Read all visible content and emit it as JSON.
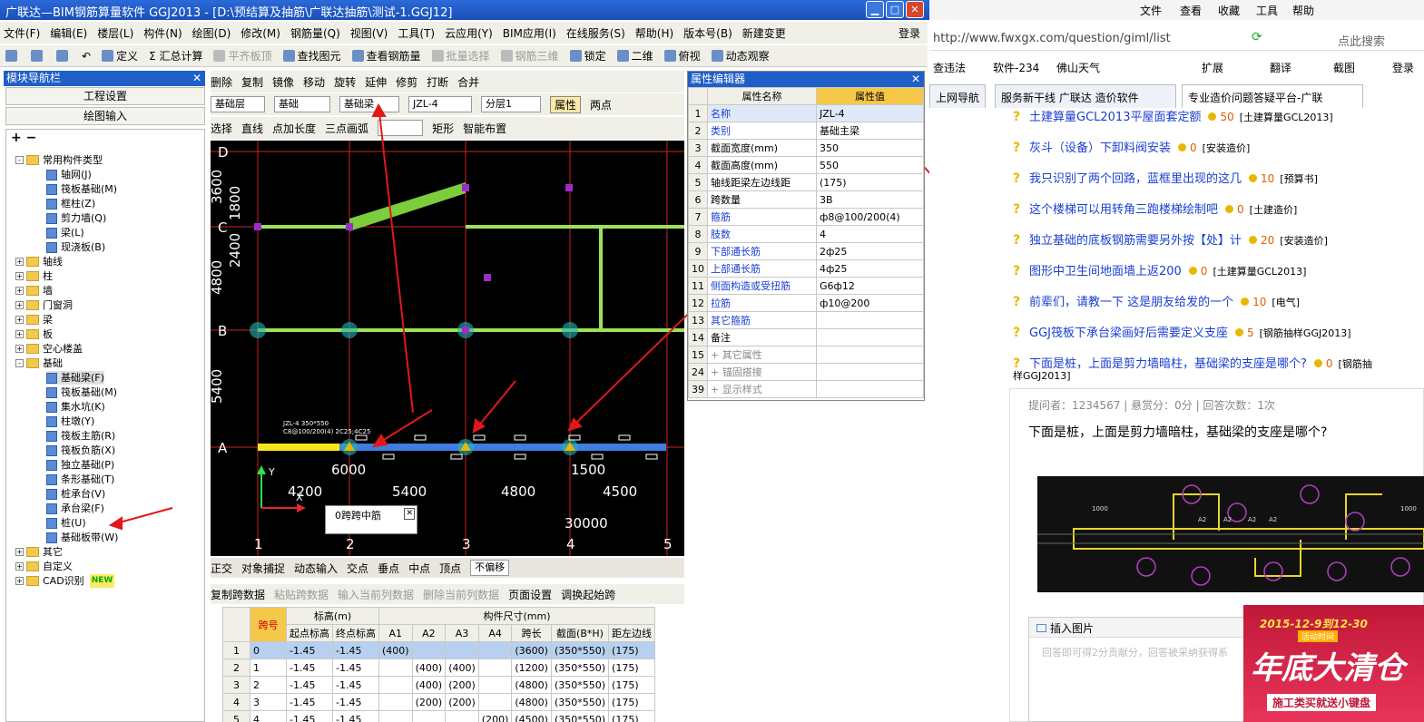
{
  "app": {
    "title": "广联达—BIM钢筋算量软件 GGJ2013 - [D:\\预结算及抽筋\\广联达抽筋\\测试-1.GGJ12]",
    "menu": [
      "文件(F)",
      "编辑(E)",
      "楼层(L)",
      "构件(N)",
      "绘图(D)",
      "修改(M)",
      "钢筋量(Q)",
      "视图(V)",
      "工具(T)",
      "云应用(Y)",
      "BIM应用(I)",
      "在线服务(S)",
      "帮助(H)",
      "版本号(B)",
      "新建变更"
    ],
    "login": "登录",
    "toolbar": [
      "定义",
      "Σ 汇总计算",
      "平齐板顶",
      "查找图元",
      "查看钢筋量",
      "批量选择",
      "钢筋三维",
      "锁定",
      "二维",
      "俯视",
      "动态观察"
    ],
    "edit_toolbar": [
      "删除",
      "复制",
      "镜像",
      "移动",
      "旋转",
      "延伸",
      "修剪",
      "打断",
      "合并"
    ],
    "layer_combo": [
      "基础层",
      "基础",
      "基础梁",
      "JZL-4",
      "分层1"
    ],
    "attr_button": "属性",
    "two_point": "两点",
    "draw_toolbar": [
      "选择",
      "直线",
      "点加长度",
      "三点画弧",
      "矩形",
      "智能布置"
    ]
  },
  "nav": {
    "header": "模块导航栏",
    "btn_project": "工程设置",
    "btn_draw": "绘图输入",
    "tree": [
      {
        "t": "常用构件类型",
        "lvl": 1,
        "exp": "-",
        "k": "f"
      },
      {
        "t": "轴网(J)",
        "lvl": 2,
        "k": "i"
      },
      {
        "t": "筏板基础(M)",
        "lvl": 2,
        "k": "i"
      },
      {
        "t": "框柱(Z)",
        "lvl": 2,
        "k": "i"
      },
      {
        "t": "剪力墙(Q)",
        "lvl": 2,
        "k": "i"
      },
      {
        "t": "梁(L)",
        "lvl": 2,
        "k": "i"
      },
      {
        "t": "现浇板(B)",
        "lvl": 2,
        "k": "i"
      },
      {
        "t": "轴线",
        "lvl": 1,
        "exp": "+",
        "k": "f"
      },
      {
        "t": "柱",
        "lvl": 1,
        "exp": "+",
        "k": "f"
      },
      {
        "t": "墙",
        "lvl": 1,
        "exp": "+",
        "k": "f"
      },
      {
        "t": "门窗洞",
        "lvl": 1,
        "exp": "+",
        "k": "f"
      },
      {
        "t": "梁",
        "lvl": 1,
        "exp": "+",
        "k": "f"
      },
      {
        "t": "板",
        "lvl": 1,
        "exp": "+",
        "k": "f"
      },
      {
        "t": "空心楼盖",
        "lvl": 1,
        "exp": "+",
        "k": "f"
      },
      {
        "t": "基础",
        "lvl": 1,
        "exp": "-",
        "k": "f"
      },
      {
        "t": "基础梁(F)",
        "lvl": 2,
        "k": "i",
        "sel": true
      },
      {
        "t": "筏板基础(M)",
        "lvl": 2,
        "k": "i"
      },
      {
        "t": "集水坑(K)",
        "lvl": 2,
        "k": "i"
      },
      {
        "t": "柱墩(Y)",
        "lvl": 2,
        "k": "i"
      },
      {
        "t": "筏板主筋(R)",
        "lvl": 2,
        "k": "i"
      },
      {
        "t": "筏板负筋(X)",
        "lvl": 2,
        "k": "i"
      },
      {
        "t": "独立基础(P)",
        "lvl": 2,
        "k": "i"
      },
      {
        "t": "条形基础(T)",
        "lvl": 2,
        "k": "i"
      },
      {
        "t": "桩承台(V)",
        "lvl": 2,
        "k": "i"
      },
      {
        "t": "承台梁(F)",
        "lvl": 2,
        "k": "i"
      },
      {
        "t": "桩(U)",
        "lvl": 2,
        "k": "i"
      },
      {
        "t": "基础板带(W)",
        "lvl": 2,
        "k": "i"
      },
      {
        "t": "其它",
        "lvl": 1,
        "exp": "+",
        "k": "f"
      },
      {
        "t": "自定义",
        "lvl": 1,
        "exp": "+",
        "k": "f"
      },
      {
        "t": "CAD识别",
        "lvl": 1,
        "exp": "+",
        "k": "f",
        "new": "NEW"
      }
    ]
  },
  "cad": {
    "axis_letters": [
      "D",
      "C",
      "B",
      "A"
    ],
    "axis_numbers": [
      "1",
      "2",
      "3",
      "4",
      "5"
    ],
    "dims_left": [
      "3600",
      "1800",
      "2400",
      "4800",
      "5400"
    ],
    "dims_bottom": [
      "4200",
      "6000",
      "5400",
      "4800",
      "4500",
      "1500",
      "30000"
    ],
    "beam_label": "JZL-4 350*550",
    "beam_label2": "C8@100/200(4) 2C25;4C25",
    "popup": "0跨跨中筋",
    "y_axis": "Y",
    "x_axis": "X"
  },
  "props": {
    "header": "属性编辑器",
    "col_name": "属性名称",
    "col_value": "属性值",
    "rows": [
      {
        "n": "1",
        "name": "名称",
        "val": "JZL-4",
        "c": "b"
      },
      {
        "n": "2",
        "name": "类别",
        "val": "基础主梁",
        "c": "b"
      },
      {
        "n": "3",
        "name": "截面宽度(mm)",
        "val": "350",
        "c": ""
      },
      {
        "n": "4",
        "name": "截面高度(mm)",
        "val": "550",
        "c": ""
      },
      {
        "n": "5",
        "name": "轴线距梁左边线距",
        "val": "(175)",
        "c": ""
      },
      {
        "n": "6",
        "name": "跨数量",
        "val": "3B",
        "c": ""
      },
      {
        "n": "7",
        "name": "箍筋",
        "val": "ф8@100/200(4)",
        "c": "b"
      },
      {
        "n": "8",
        "name": "肢数",
        "val": "4",
        "c": "b"
      },
      {
        "n": "9",
        "name": "下部通长筋",
        "val": "2ф25",
        "c": "b"
      },
      {
        "n": "10",
        "name": "上部通长筋",
        "val": "4ф25",
        "c": "b"
      },
      {
        "n": "11",
        "name": "侧面构造或受扭筋",
        "val": "G6ф12",
        "c": "b"
      },
      {
        "n": "12",
        "name": "拉筋",
        "val": "ф10@200",
        "c": "b"
      },
      {
        "n": "13",
        "name": "其它箍筋",
        "val": "",
        "c": "b"
      },
      {
        "n": "14",
        "name": "备注",
        "val": "",
        "c": ""
      },
      {
        "n": "15",
        "name": "+ 其它属性",
        "val": "",
        "c": "g"
      },
      {
        "n": "24",
        "name": "+ 锚固搭接",
        "val": "",
        "c": "g"
      },
      {
        "n": "39",
        "name": "+ 显示样式",
        "val": "",
        "c": "g"
      }
    ]
  },
  "snapbar": [
    "正交",
    "对象捕捉",
    "动态输入",
    "交点",
    "垂点",
    "中点",
    "顶点",
    "不偏移"
  ],
  "spanbar": [
    "复制跨数据",
    "粘贴跨数据",
    "输入当前列数据",
    "删除当前列数据",
    "页面设置",
    "调换起始跨"
  ],
  "span_table": {
    "h_span": "跨号",
    "h_elev": "标高(m)",
    "h_size": "构件尺寸(mm)",
    "h_cols": [
      "起点标高",
      "终点标高",
      "A1",
      "A2",
      "A3",
      "A4",
      "跨长",
      "截面(B*H)",
      "距左边线"
    ],
    "rows": [
      [
        "1",
        "0",
        "-1.45",
        "-1.45",
        "(400)",
        "",
        "",
        "",
        "(3600)",
        "(350*550)",
        "(175)"
      ],
      [
        "2",
        "1",
        "-1.45",
        "-1.45",
        "",
        "(400)",
        "(400)",
        "",
        "(1200)",
        "(350*550)",
        "(175)"
      ],
      [
        "3",
        "2",
        "-1.45",
        "-1.45",
        "",
        "(400)",
        "(200)",
        "",
        "(4800)",
        "(350*550)",
        "(175)"
      ],
      [
        "4",
        "3",
        "-1.45",
        "-1.45",
        "",
        "(200)",
        "(200)",
        "",
        "(4800)",
        "(350*550)",
        "(175)"
      ],
      [
        "5",
        "4",
        "-1.45",
        "-1.45",
        "",
        "",
        "",
        "(200)",
        "(4500)",
        "(350*550)",
        "(175)"
      ]
    ]
  },
  "browser": {
    "menu": [
      "文件",
      "查看",
      "收藏",
      "工具",
      "帮助"
    ],
    "url": "http://www.fwxgx.com/question/giml/list",
    "search": "点此搜索",
    "bookmarks": [
      "查违法",
      "软件-234",
      "佛山天气",
      "扩展",
      "翻译",
      "截图",
      "登录"
    ],
    "tabs": [
      "上网导航",
      "服务新干线 广联达 造价软件",
      "专业造价问题答疑平台-广联"
    ],
    "questions": [
      {
        "q": "土建算量GCL2013平屋面套定额",
        "s": "50",
        "tag": "[土建算量GCL2013]"
      },
      {
        "q": "灰斗（设备）下卸料阀安装",
        "s": "0",
        "tag": "[安装造价]"
      },
      {
        "q": "我只识别了两个回路，蓝框里出现的这几",
        "s": "10",
        "tag": "[预算书]"
      },
      {
        "q": "这个楼梯可以用转角三跑楼梯绘制吧",
        "s": "0",
        "tag": "[土建造价]"
      },
      {
        "q": "独立基础的底板钢筋需要另外按【处】计",
        "s": "20",
        "tag": "[安装造价]"
      },
      {
        "q": "图形中卫生间地面墙上返200",
        "s": "0",
        "tag": "[土建算量GCL2013]"
      },
      {
        "q": "前辈们，请教一下 这是朋友给发的一个",
        "s": "10",
        "tag": "[电气]"
      },
      {
        "q": "GGJ筏板下承台梁画好后需要定义支座",
        "s": "5",
        "tag": "[钢筋抽样GGJ2013]"
      },
      {
        "q": "下面是桩，上面是剪力墙暗柱，基础梁的支座是哪个?",
        "s": "0",
        "tag": "[钢筋抽"
      }
    ],
    "tag_cont": "样GGJ2013]",
    "meta": "提问者：1234567  |  悬赏分：0分  |  回答次数：1次",
    "detail": "下面是桩，上面是剪力墙暗柱，基础梁的支座是哪个?",
    "insert_img": "插入图片",
    "answer_ph": "回答即可得2分贡献分，回答被采纳获得系",
    "ad_date": "2015-12-9到12-30",
    "ad_sub": "活动时间",
    "ad_main": "年底大清仓",
    "ad_foot": "施工类买就送小键盘",
    "thumb_labels": [
      "1000",
      "A2",
      "A2",
      "A2",
      "A2",
      "1000"
    ]
  }
}
